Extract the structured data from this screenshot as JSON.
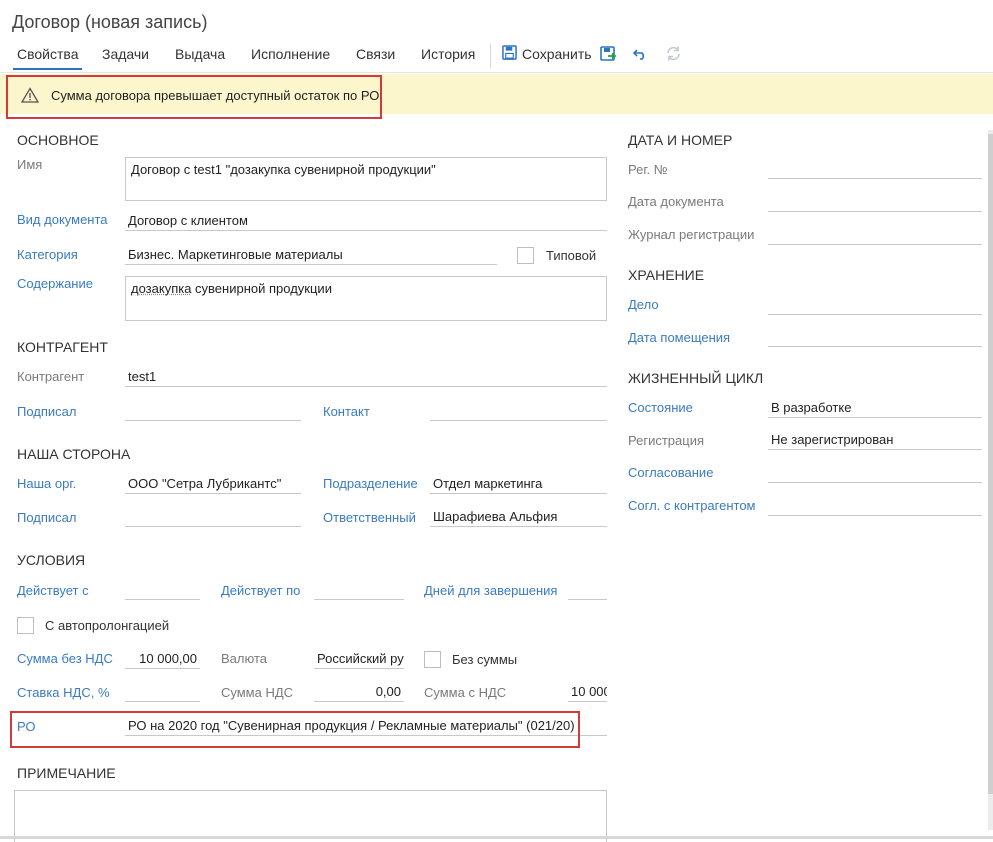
{
  "title": "Договор (новая запись)",
  "tabs": [
    "Свойства",
    "Задачи",
    "Выдача",
    "Исполнение",
    "Связи",
    "История"
  ],
  "toolbar": {
    "save_label": "Сохранить"
  },
  "banner": {
    "text": "Сумма договора превышает доступный остаток по РО."
  },
  "sections": {
    "main": "ОСНОВНОЕ",
    "counterparty": "КОНТРАГЕНТ",
    "our_side": "НАША СТОРОНА",
    "conditions": "УСЛОВИЯ",
    "note": "ПРИМЕЧАНИЕ",
    "date_number": "ДАТА И НОМЕР",
    "storage": "ХРАНЕНИЕ",
    "lifecycle": "ЖИЗНЕННЫЙ ЦИКЛ"
  },
  "main": {
    "name_label": "Имя",
    "name_value": "Договор с test1 \"дозакупка сувенирной продукции\"",
    "doctype_label": "Вид документа",
    "doctype_value": "Договор с клиентом",
    "category_label": "Категория",
    "category_value": "Бизнес. Маркетинговые материалы",
    "typical_label": "Типовой",
    "content_label": "Содержание",
    "content_word1": "дозакупка",
    "content_rest": " сувенирной продукции"
  },
  "counterparty": {
    "counterparty_label": "Контрагент",
    "counterparty_value": "test1",
    "signed_label": "Подписал",
    "signed_value": "",
    "contact_label": "Контакт",
    "contact_value": ""
  },
  "our_side": {
    "org_label": "Наша орг.",
    "org_value": "ООО \"Сетра Лубрикантс\"",
    "dept_label": "Подразделение",
    "dept_value": "Отдел маркетинга",
    "signed_label": "Подписал",
    "signed_value": "",
    "resp_label": "Ответственный",
    "resp_value": "Шарафиева Альфия"
  },
  "conditions": {
    "valid_from_label": "Действует с",
    "valid_to_label": "Действует по",
    "days_label": "Дней для завершения",
    "autoprolong_label": "С автопролонгацией",
    "sum_no_vat_label": "Сумма без НДС",
    "sum_no_vat_value": "10 000,00",
    "currency_label": "Валюта",
    "currency_value": "Российский ру",
    "no_sum_label": "Без суммы",
    "vat_rate_label": "Ставка НДС, %",
    "vat_sum_label": "Сумма НДС",
    "vat_sum_value": "0,00",
    "sum_with_vat_label": "Сумма с НДС",
    "sum_with_vat_value": "10 000",
    "ro_label": "РО",
    "ro_value": "РО на 2020 год \"Сувенирная продукция / Рекламные материалы\" (021/20)"
  },
  "right": {
    "reg_no_label": "Рег. №",
    "doc_date_label": "Дата документа",
    "journal_label": "Журнал регистрации",
    "case_label": "Дело",
    "placed_date_label": "Дата помещения",
    "state_label": "Состояние",
    "state_value": "В разработке",
    "registration_label": "Регистрация",
    "registration_value": "Не зарегистрирован",
    "approval_label": "Согласование",
    "counter_approval_label": "Согл. с контрагентом"
  },
  "colors": {
    "accent": "#2a74c4",
    "link": "#3a7bbf",
    "banner_bg": "#fcf6cc",
    "highlight": "#d53a3a"
  }
}
